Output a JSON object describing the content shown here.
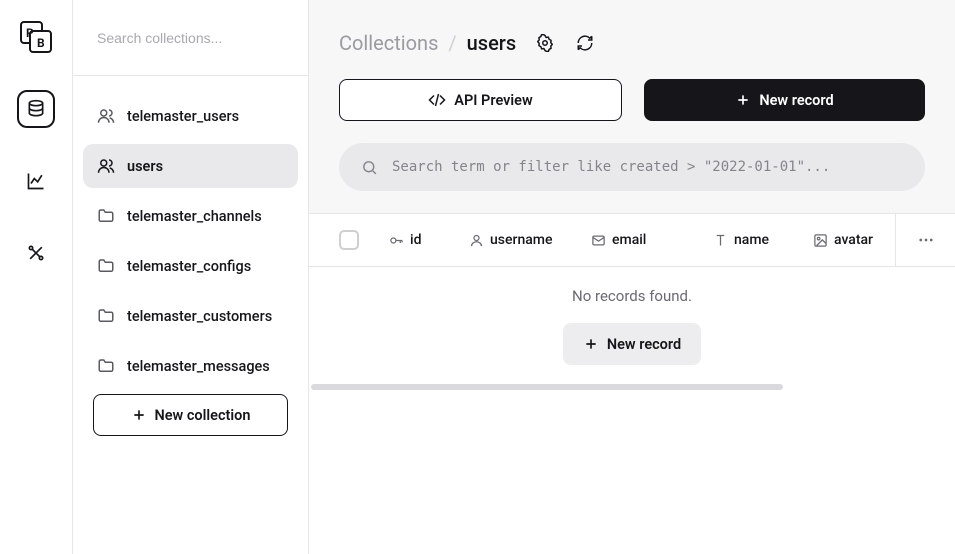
{
  "sidebar": {
    "search_placeholder": "Search collections...",
    "items": [
      {
        "label": "telemaster_users",
        "icon": "user",
        "active": false
      },
      {
        "label": "users",
        "icon": "user",
        "active": true
      },
      {
        "label": "telemaster_channels",
        "icon": "folder",
        "active": false
      },
      {
        "label": "telemaster_configs",
        "icon": "folder",
        "active": false
      },
      {
        "label": "telemaster_customers",
        "icon": "folder",
        "active": false
      },
      {
        "label": "telemaster_messages",
        "icon": "folder",
        "active": false
      }
    ],
    "new_collection_label": "New collection"
  },
  "header": {
    "breadcrumb_root": "Collections",
    "breadcrumb_sep": "/",
    "breadcrumb_current": "users",
    "api_preview_label": "API Preview",
    "new_record_label": "New record",
    "filter_placeholder": "Search term or filter like created > \"2022-01-01\"..."
  },
  "columns": [
    {
      "key": "id",
      "label": "id",
      "icon": "key"
    },
    {
      "key": "username",
      "label": "username",
      "icon": "user"
    },
    {
      "key": "email",
      "label": "email",
      "icon": "mail"
    },
    {
      "key": "name",
      "label": "name",
      "icon": "text"
    },
    {
      "key": "avatar",
      "label": "avatar",
      "icon": "image"
    }
  ],
  "empty": {
    "message": "No records found.",
    "new_record_label": "New record"
  },
  "colors": {
    "border": "#e6e6e8",
    "muted_bg": "#f7f7f8",
    "chip_bg": "#e9e9ec",
    "text": "#16161a"
  }
}
